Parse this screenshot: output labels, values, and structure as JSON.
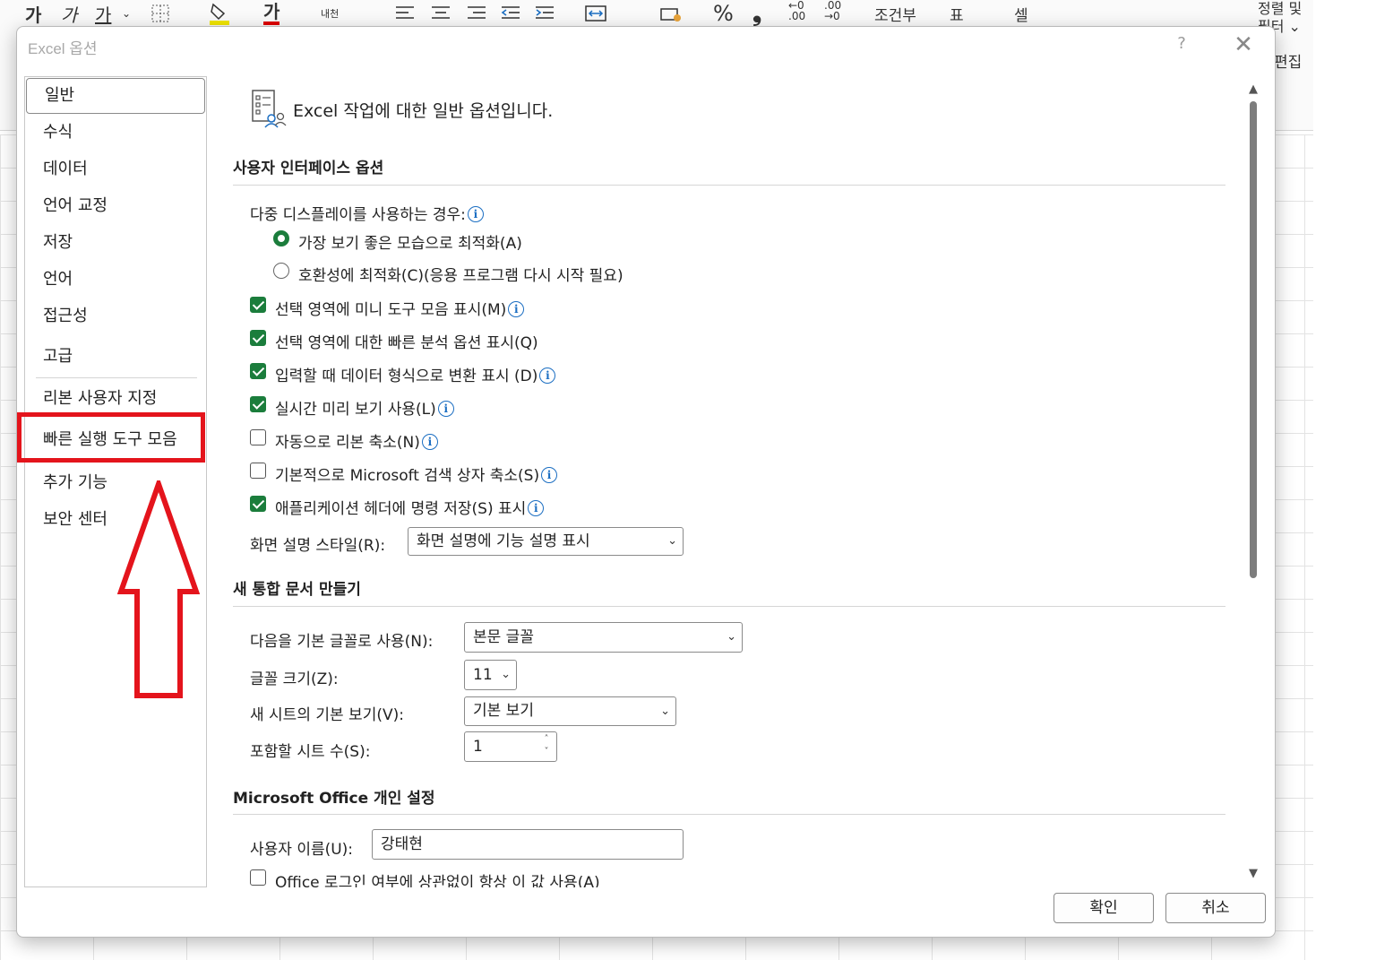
{
  "background": {
    "ribbon_glyphs": [
      "가",
      "가",
      "가",
      "내천",
      "%",
      "조건부",
      "표",
      "셀"
    ],
    "ribbon_right_top": "정렬 및",
    "ribbon_right_mid": "필터",
    "ribbon_edit_label": "편집"
  },
  "dialog": {
    "title": "Excel 옵션",
    "help": "?",
    "close": "✕"
  },
  "sidebar": {
    "items": [
      {
        "label": "일반"
      },
      {
        "label": "수식"
      },
      {
        "label": "데이터"
      },
      {
        "label": "언어 교정"
      },
      {
        "label": "저장"
      },
      {
        "label": "언어"
      },
      {
        "label": "접근성"
      },
      {
        "label": "고급"
      },
      {
        "label": "리본 사용자 지정"
      },
      {
        "label": "빠른 실행 도구 모음"
      },
      {
        "label": "추가 기능"
      },
      {
        "label": "보안 센터"
      }
    ],
    "selected_index": 0,
    "highlighted_index": 9,
    "annotation_color": "#e4141c"
  },
  "main": {
    "header": "Excel 작업에 대한 일반 옵션입니다.",
    "ui_section": {
      "title": "사용자 인터페이스 옵션",
      "multi_display_label": "다중 디스플레이를 사용하는 경우:",
      "radio_optimize": "가장 보기 좋은 모습으로 최적화(A)",
      "radio_compat": "호환성에 최적화(C)(응용 프로그램 다시 시작 필요)",
      "checkboxes": [
        {
          "label": "선택 영역에 미니 도구 모음 표시(M)",
          "checked": true,
          "info": true
        },
        {
          "label": "선택 영역에 대한 빠른 분석 옵션 표시(Q)",
          "checked": true,
          "info": false
        },
        {
          "label": "입력할 때 데이터 형식으로 변환 표시 (D)",
          "checked": true,
          "info": true
        },
        {
          "label": "실시간 미리 보기 사용(L)",
          "checked": true,
          "info": true
        },
        {
          "label": "자동으로 리본 축소(N)",
          "checked": false,
          "info": true
        },
        {
          "label": "기본적으로 Microsoft 검색 상자 축소(S)",
          "checked": false,
          "info": true
        },
        {
          "label": "애플리케이션 헤더에 명령 저장(S) 표시",
          "checked": true,
          "info": true
        }
      ],
      "screentip_label": "화면 설명 스타일(R):",
      "screentip_value": "화면 설명에 기능 설명 표시"
    },
    "new_workbook": {
      "title": "새 통합 문서 만들기",
      "font_label": "다음을 기본 글꼴로 사용(N):",
      "font_value": "본문 글꼴",
      "size_label": "글꼴 크기(Z):",
      "size_value": "11",
      "view_label": "새 시트의 기본 보기(V):",
      "view_value": "기본 보기",
      "sheets_label": "포함할 시트 수(S):",
      "sheets_value": "1"
    },
    "personal": {
      "title": "Microsoft Office 개인 설정",
      "username_label": "사용자 이름(U):",
      "username_value": "강태현",
      "always_use_label": "Office 로그인 여부에 상관없이 항상 이 값 사용(A)",
      "always_use_checked": false
    }
  },
  "buttons": {
    "ok": "확인",
    "cancel": "취소"
  },
  "colors": {
    "checkbox_accent": "#1b7d3c",
    "info_icon": "#1b6ec2"
  }
}
